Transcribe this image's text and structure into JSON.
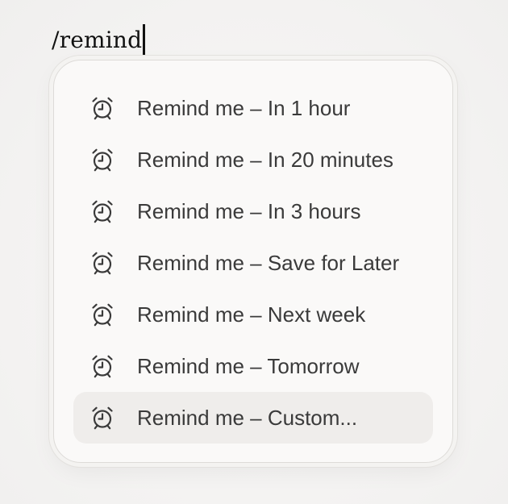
{
  "editor": {
    "command_text": "/remind"
  },
  "menu": {
    "selected_index": 6,
    "items": [
      {
        "label": "Remind me – In 1 hour",
        "icon": "alarm-clock-icon"
      },
      {
        "label": "Remind me – In 20 minutes",
        "icon": "alarm-clock-icon"
      },
      {
        "label": "Remind me – In 3 hours",
        "icon": "alarm-clock-icon"
      },
      {
        "label": "Remind me – Save for Later",
        "icon": "alarm-clock-icon"
      },
      {
        "label": "Remind me – Next week",
        "icon": "alarm-clock-icon"
      },
      {
        "label": "Remind me – Tomorrow",
        "icon": "alarm-clock-icon"
      },
      {
        "label": "Remind me – Custom...",
        "icon": "alarm-clock-icon"
      }
    ]
  },
  "colors": {
    "text": "#3a3a3a",
    "selected_background": "#efedeb",
    "menu_background": "#faf9f8"
  }
}
